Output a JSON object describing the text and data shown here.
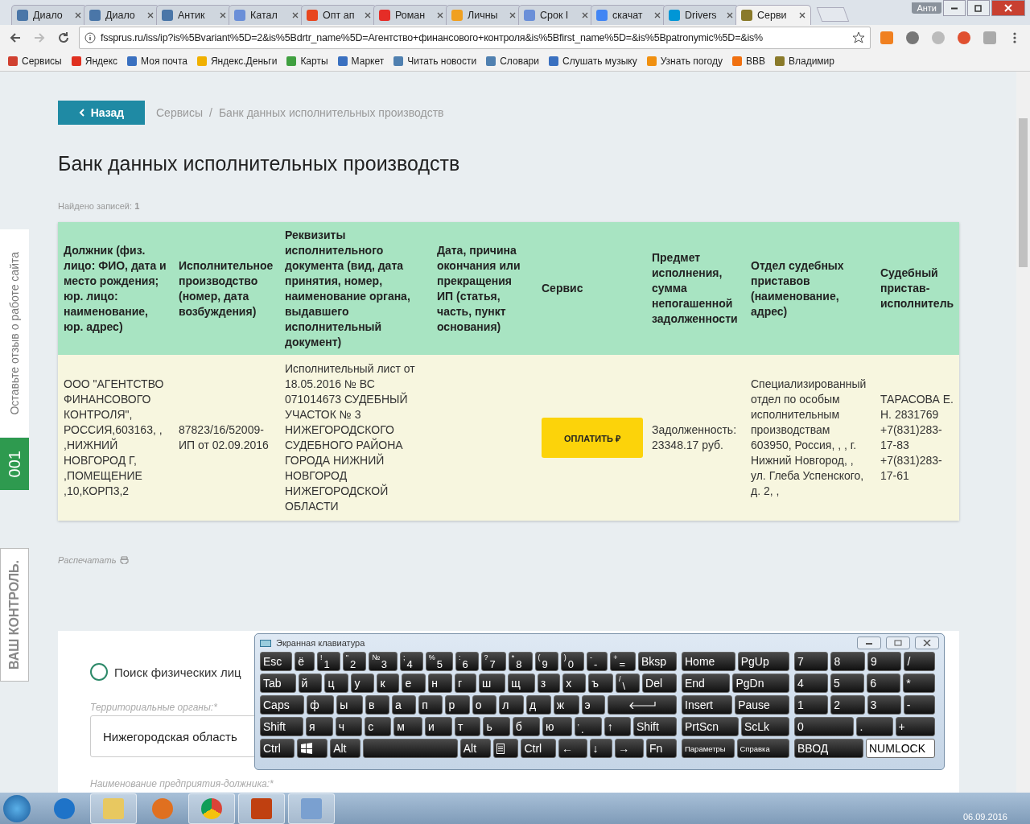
{
  "browser": {
    "tabs": [
      {
        "title": "Диало",
        "color": "#4a76a8",
        "selected": false
      },
      {
        "title": "Диало",
        "color": "#4a76a8",
        "selected": false
      },
      {
        "title": "Антик",
        "color": "#4a76a8",
        "selected": false
      },
      {
        "title": "Катал",
        "color": "#6a8fd8",
        "selected": false
      },
      {
        "title": "Опт ап",
        "color": "#e8461e",
        "selected": false
      },
      {
        "title": "Роман",
        "color": "#e52d27",
        "selected": false
      },
      {
        "title": "Личны",
        "color": "#f0a020",
        "selected": false
      },
      {
        "title": "Срок I",
        "color": "#6a8fd8",
        "selected": false
      },
      {
        "title": "скачат",
        "color": "#4285f4",
        "selected": false
      },
      {
        "title": "Drivers",
        "color": "#0096d6",
        "selected": false
      },
      {
        "title": "Серви",
        "color": "#8a7a2a",
        "selected": true
      }
    ],
    "profile": "Анти",
    "url": "fssprus.ru/iss/ip?is%5Bvariant%5D=2&is%5Bdrtr_name%5D=Агентство+финансового+контроля&is%5Bfirst_name%5D=&is%5Bpatronymic%5D=&is%",
    "bookmarks": [
      {
        "label": "Сервисы",
        "color": "#d04030"
      },
      {
        "label": "Яндекс",
        "color": "#e03020"
      },
      {
        "label": "Моя почта",
        "color": "#3a70c0"
      },
      {
        "label": "Яндекс.Деньги",
        "color": "#f0b000"
      },
      {
        "label": "Карты",
        "color": "#40a040"
      },
      {
        "label": "Маркет",
        "color": "#3a70c0"
      },
      {
        "label": "Читать новости",
        "color": "#5080b0"
      },
      {
        "label": "Словари",
        "color": "#5080b0"
      },
      {
        "label": "Слушать музыку",
        "color": "#3a70c0"
      },
      {
        "label": "Узнать погоду",
        "color": "#f09010"
      },
      {
        "label": "BBB",
        "color": "#f07010"
      },
      {
        "label": "Владимир",
        "color": "#8a7a2a"
      }
    ]
  },
  "side_tabs": {
    "feedback": "Оставьте отзыв о работе сайта",
    "counter": "001",
    "slogan": "ВАШ КОНТРОЛЬ."
  },
  "page": {
    "back_button": "Назад",
    "breadcrumbs": [
      "Сервисы",
      "Банк данных исполнительных производств"
    ],
    "breadcrumb_separator": "/",
    "title": "Банк данных исполнительных производств",
    "found": "Найдено записей: **1**",
    "table": {
      "columns": [
        "Должник (физ. лицо: ФИО, дата и место рождения; юр. лицо: наименование, юр. адрес)",
        "Исполнительное производство (номер, дата возбуждения)",
        "Реквизиты исполнительного документа (вид, дата принятия, номер, наименование органа, выдавшего исполнительный документ)",
        "Дата, причина окончания или прекращения ИП (статья, часть, пункт основания)",
        "Сервис",
        "Предмет исполнения, сумма непогашенной задолженности",
        "Отдел судебных приставов (наименование, адрес)",
        "Судебный пристав-исполнитель"
      ],
      "rows": [
        {
          "debtor": "ООО \"АГЕНТСТВО ФИНАНСОВОГО КОНТРОЛЯ\", РОССИЯ,603163, , ,НИЖНИЙ НОВГОРОД Г, ,ПОМЕЩЕНИЕ ,10,КОРП3,2",
          "proceeding": "87823/16/52009-ИП от 02.09.2016",
          "document": "Исполнительный лист от 18.05.2016 № ВС 071014673 СУДЕБНЫЙ УЧАСТОК № 3 НИЖЕГОРОДСКОГО СУДЕБНОГО РАЙОНА ГОРОДА НИЖНИЙ НОВГОРОД НИЖЕГОРОДСКОЙ ОБЛАСТИ",
          "pay_button": "ОПЛАТИТЬ ₽",
          "subject": "Задолженность: 23348.17 руб.",
          "department": "Специализированный отдел по особым исполнительным производствам 603950, Россия, , , г. Нижний Новгород, , ул. Глеба Успенского, д. 2, ,",
          "bailiff": "ТАРАСОВА Е. Н. 2831769 +7(831)283-17-83 +7(831)283-17-61"
        }
      ]
    },
    "print_link": "Распечатать",
    "form": {
      "radio": {
        "label": "Поиск физических лиц",
        "selected": false
      },
      "region_label": "Территориальные органы:*",
      "region_value": "Нижегородская область",
      "next_label": "Наименование предприятия-должника:*"
    }
  },
  "keyboard": {
    "title": "Экранная клавиатура",
    "main_rows": [
      [
        {
          "kind": "key",
          "label": "Esc"
        },
        {
          "kind": "key",
          "label": "ё"
        },
        {
          "kind": "key",
          "label": "1",
          "shift": "!"
        },
        {
          "kind": "key",
          "label": "2",
          "shift": "\""
        },
        {
          "kind": "key",
          "label": "3",
          "shift": "№"
        },
        {
          "kind": "key",
          "label": "4",
          "shift": ";"
        },
        {
          "kind": "key",
          "label": "5",
          "shift": "%"
        },
        {
          "kind": "key",
          "label": "6",
          "shift": ":"
        },
        {
          "kind": "key",
          "label": "7",
          "shift": "?"
        },
        {
          "kind": "key",
          "label": "8",
          "shift": "*"
        },
        {
          "kind": "key",
          "label": "9",
          "shift": "("
        },
        {
          "kind": "key",
          "label": "0",
          "shift": ")"
        },
        {
          "kind": "key",
          "label": "-",
          "shift": "-"
        },
        {
          "kind": "key",
          "label": "=",
          "shift": "+"
        },
        {
          "kind": "key",
          "label": "Bksp"
        }
      ],
      [
        {
          "kind": "key",
          "label": "Tab"
        },
        {
          "kind": "key",
          "label": "й"
        },
        {
          "kind": "key",
          "label": "ц"
        },
        {
          "kind": "key",
          "label": "у"
        },
        {
          "kind": "key",
          "label": "к"
        },
        {
          "kind": "key",
          "label": "е"
        },
        {
          "kind": "key",
          "label": "н"
        },
        {
          "kind": "key",
          "label": "г"
        },
        {
          "kind": "key",
          "label": "ш"
        },
        {
          "kind": "key",
          "label": "щ"
        },
        {
          "kind": "key",
          "label": "з"
        },
        {
          "kind": "key",
          "label": "х"
        },
        {
          "kind": "key",
          "label": "ъ"
        },
        {
          "kind": "key",
          "label": "\\",
          "shift": "/"
        },
        {
          "kind": "key",
          "label": "Del"
        }
      ],
      [
        {
          "kind": "key",
          "label": "Caps"
        },
        {
          "kind": "key",
          "label": "ф"
        },
        {
          "kind": "key",
          "label": "ы"
        },
        {
          "kind": "key",
          "label": "в"
        },
        {
          "kind": "key",
          "label": "а"
        },
        {
          "kind": "key",
          "label": "п"
        },
        {
          "kind": "key",
          "label": "р"
        },
        {
          "kind": "key",
          "label": "о"
        },
        {
          "kind": "key",
          "label": "л"
        },
        {
          "kind": "key",
          "label": "д"
        },
        {
          "kind": "key",
          "label": "ж"
        },
        {
          "kind": "key",
          "label": "э"
        },
        {
          "kind": "enter"
        }
      ],
      [
        {
          "kind": "key",
          "label": "Shift"
        },
        {
          "kind": "key",
          "label": "я"
        },
        {
          "kind": "key",
          "label": "ч"
        },
        {
          "kind": "key",
          "label": "с"
        },
        {
          "kind": "key",
          "label": "м"
        },
        {
          "kind": "key",
          "label": "и"
        },
        {
          "kind": "key",
          "label": "т"
        },
        {
          "kind": "key",
          "label": "ь"
        },
        {
          "kind": "key",
          "label": "б"
        },
        {
          "kind": "key",
          "label": "ю"
        },
        {
          "kind": "key",
          "label": ".",
          "shift": ","
        },
        {
          "kind": "key",
          "label": "↑"
        },
        {
          "kind": "key",
          "label": "Shift"
        }
      ],
      [
        {
          "kind": "key",
          "label": "Ctrl"
        },
        {
          "kind": "win"
        },
        {
          "kind": "key",
          "label": "Alt"
        },
        {
          "kind": "space"
        },
        {
          "kind": "key",
          "label": "Alt"
        },
        {
          "kind": "menu"
        },
        {
          "kind": "key",
          "label": "Ctrl"
        },
        {
          "kind": "key",
          "label": "←"
        },
        {
          "kind": "key",
          "label": "↓"
        },
        {
          "kind": "key",
          "label": "→"
        },
        {
          "kind": "key",
          "label": "Fn"
        }
      ]
    ],
    "nav_rows": [
      [
        {
          "kind": "key",
          "label": "Home"
        },
        {
          "kind": "key",
          "label": "PgUp"
        }
      ],
      [
        {
          "kind": "key",
          "label": "End"
        },
        {
          "kind": "key",
          "label": "PgDn"
        }
      ],
      [
        {
          "kind": "key",
          "label": "Insert"
        },
        {
          "kind": "key",
          "label": "Pause"
        }
      ],
      [
        {
          "kind": "key",
          "label": "PrtScn"
        },
        {
          "kind": "key",
          "label": "ScLk"
        }
      ],
      [
        {
          "kind": "small",
          "label": "Параметры"
        },
        {
          "kind": "small",
          "label": "Справка"
        }
      ]
    ],
    "numpad_rows": [
      [
        {
          "kind": "key",
          "label": "7"
        },
        {
          "kind": "key",
          "label": "8"
        },
        {
          "kind": "key",
          "label": "9"
        },
        {
          "kind": "key",
          "label": "/"
        }
      ],
      [
        {
          "kind": "key",
          "label": "4"
        },
        {
          "kind": "key",
          "label": "5"
        },
        {
          "kind": "key",
          "label": "6"
        },
        {
          "kind": "key",
          "label": "*"
        }
      ],
      [
        {
          "kind": "key",
          "label": "1"
        },
        {
          "kind": "key",
          "label": "2"
        },
        {
          "kind": "key",
          "label": "3"
        },
        {
          "kind": "key",
          "label": "-"
        }
      ],
      [
        {
          "kind": "wide",
          "label": "0"
        },
        {
          "kind": "key",
          "label": "."
        },
        {
          "kind": "key",
          "label": "+"
        }
      ],
      [
        {
          "kind": "wide",
          "label": "ВВОД"
        },
        {
          "kind": "wide",
          "label": "NUMLOCK",
          "on": true
        }
      ]
    ]
  },
  "taskbar": {
    "date": "06.09.2016"
  }
}
